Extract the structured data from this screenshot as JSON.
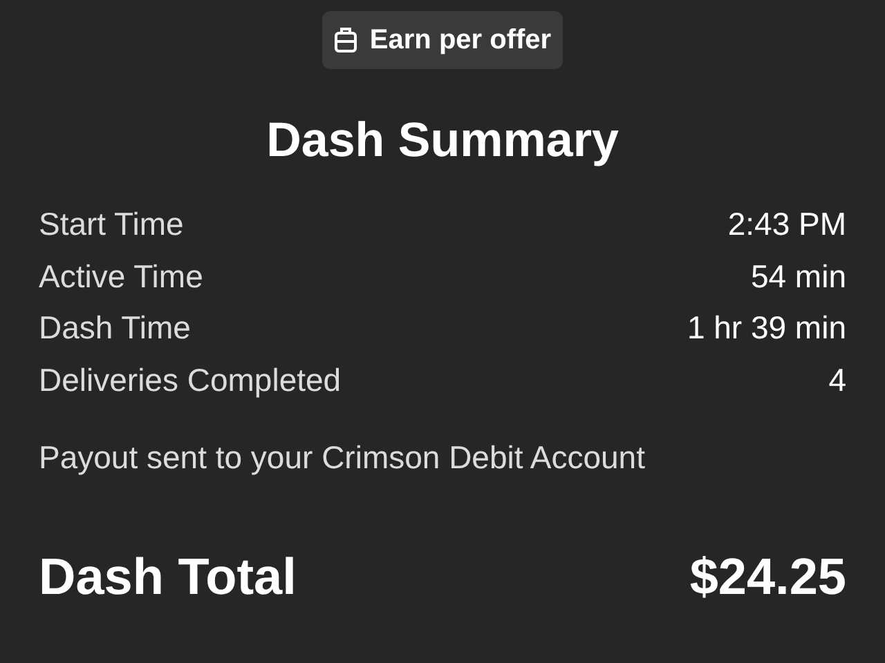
{
  "badge": {
    "label": "Earn per offer"
  },
  "title": "Dash Summary",
  "stats": [
    {
      "label": "Start Time",
      "value": "2:43 PM"
    },
    {
      "label": "Active Time",
      "value": "54 min"
    },
    {
      "label": "Dash Time",
      "value": "1 hr 39 min"
    },
    {
      "label": "Deliveries Completed",
      "value": "4"
    }
  ],
  "payout_note": "Payout sent to your Crimson Debit Account",
  "total": {
    "label": "Dash Total",
    "value": "$24.25"
  }
}
